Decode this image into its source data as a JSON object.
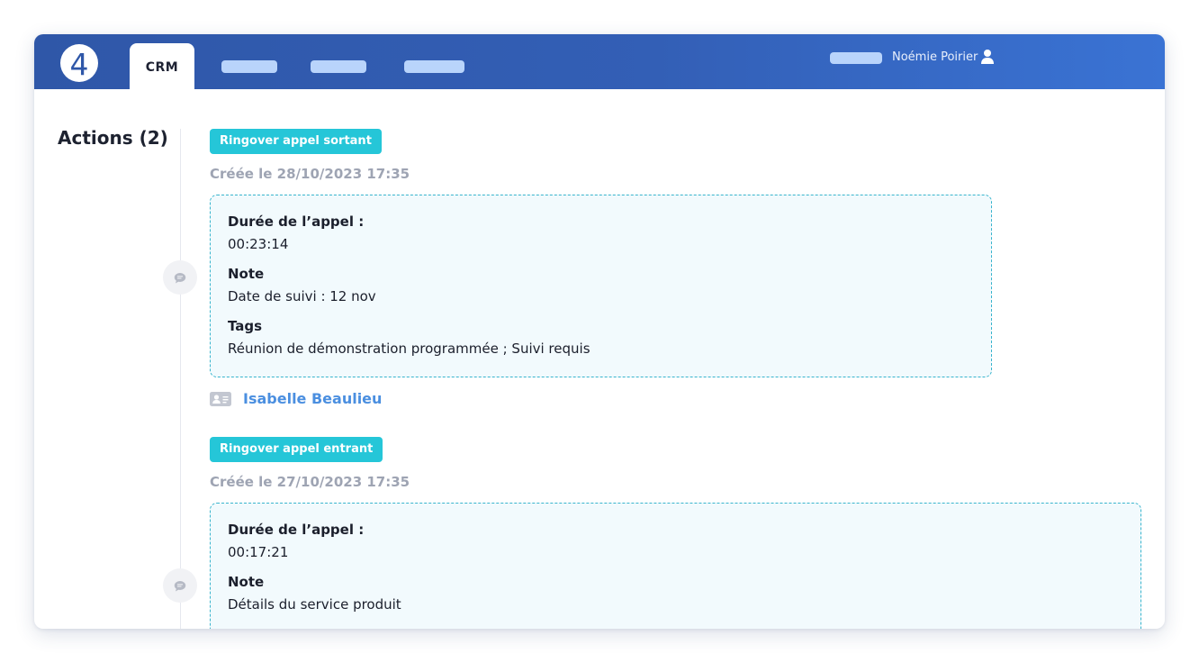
{
  "header": {
    "logo_text": "4",
    "active_tab": "CRM",
    "user_name": "Noémie Poirier",
    "brand_color": "#2f57a8",
    "accent_color": "#3a73d4"
  },
  "sidebar": {
    "title": "Actions (2)"
  },
  "actions": [
    {
      "badge": "Ringover appel sortant",
      "created": "Créée le 28/10/2023 17:35",
      "fields": [
        {
          "label": "Durée de l’appel :",
          "value": "00:23:14"
        },
        {
          "label": "Note",
          "value": "Date de suivi : 12 nov"
        },
        {
          "label": "Tags",
          "value": "Réunion de démonstration programmée ; Suivi requis"
        }
      ],
      "contact": "Isabelle Beaulieu"
    },
    {
      "badge": "Ringover appel entrant",
      "created": "Créée le 27/10/2023 17:35",
      "fields": [
        {
          "label": "Durée de l’appel :",
          "value": "00:17:21"
        },
        {
          "label": "Note",
          "value": "Détails du service produit"
        }
      ]
    }
  ],
  "icons": {
    "logo": "brand-logo-icon",
    "user": "user-icon",
    "timeline": "chat-bubble-icon",
    "contact": "contact-card-icon"
  },
  "colors": {
    "badge": "#25c6d8",
    "card_border": "#38b4cd",
    "card_background": "#f2fafd",
    "contact_link": "#4b8fe0"
  }
}
